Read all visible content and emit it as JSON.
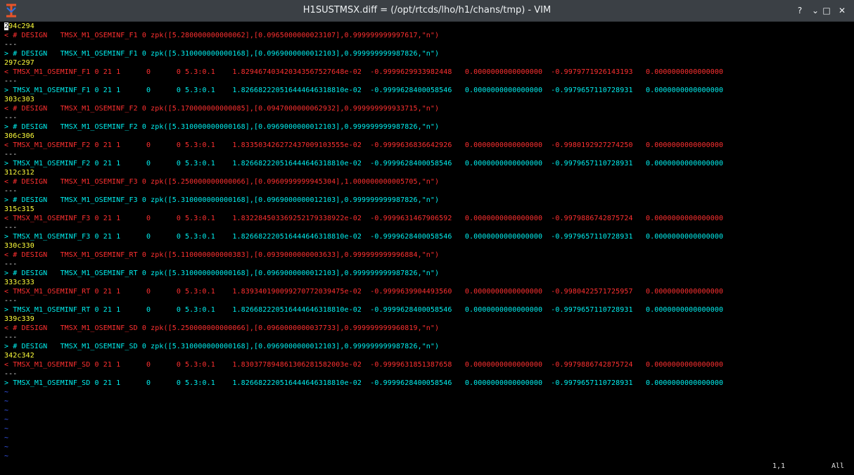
{
  "window": {
    "title": "H1SUSTMSX.diff = (/opt/rtcds/lho/h1/chans/tmp) - VIM",
    "buttons": {
      "help": "?",
      "minimize": "⌄",
      "maximize": "□",
      "close": "✕"
    }
  },
  "colors": {
    "hunk": "#ffff3c",
    "removed": "#ff3030",
    "added": "#00f0f0",
    "separator": "#e8e8e8",
    "tilde": "#3a5cff"
  },
  "lines": [
    {
      "type": "hunk",
      "text": "294c294"
    },
    {
      "type": "removed",
      "text": "< # DESIGN   TMSX_M1_OSEMINF_F1 0 zpk([5.280000000000062],[0.0965000000023107],0.999999999997617,\"n\")"
    },
    {
      "type": "separator",
      "text": "---"
    },
    {
      "type": "added",
      "text": "> # DESIGN   TMSX_M1_OSEMINF_F1 0 zpk([5.310000000000168],[0.0969000000012103],0.999999999987826,\"n\")"
    },
    {
      "type": "hunk",
      "text": "297c297"
    },
    {
      "type": "removed",
      "text": "< TMSX_M1_OSEMINF_F1 0 21 1      0      0 5.3:0.1    1.829467403420343567527648e-02  -0.9999629933982448   0.0000000000000000  -0.9979771926143193   0.0000000000000000"
    },
    {
      "type": "separator",
      "text": "---"
    },
    {
      "type": "added",
      "text": "> TMSX_M1_OSEMINF_F1 0 21 1      0      0 5.3:0.1    1.826682220516444646318810e-02  -0.9999628400058546   0.0000000000000000  -0.9979657110728931   0.0000000000000000"
    },
    {
      "type": "hunk",
      "text": "303c303"
    },
    {
      "type": "removed",
      "text": "< # DESIGN   TMSX_M1_OSEMINF_F2 0 zpk([5.170000000000085],[0.0947000000062932],0.999999999933715,\"n\")"
    },
    {
      "type": "separator",
      "text": "---"
    },
    {
      "type": "added",
      "text": "> # DESIGN   TMSX_M1_OSEMINF_F2 0 zpk([5.310000000000168],[0.0969000000012103],0.999999999987826,\"n\")"
    },
    {
      "type": "hunk",
      "text": "306c306"
    },
    {
      "type": "removed",
      "text": "< TMSX_M1_OSEMINF_F2 0 21 1      0      0 5.3:0.1    1.833503426272437009103555e-02  -0.9999636836642926   0.0000000000000000  -0.9980192927274250   0.0000000000000000"
    },
    {
      "type": "separator",
      "text": "---"
    },
    {
      "type": "added",
      "text": "> TMSX_M1_OSEMINF_F2 0 21 1      0      0 5.3:0.1    1.826682220516444646318810e-02  -0.9999628400058546   0.0000000000000000  -0.9979657110728931   0.0000000000000000"
    },
    {
      "type": "hunk",
      "text": "312c312"
    },
    {
      "type": "removed",
      "text": "< # DESIGN   TMSX_M1_OSEMINF_F3 0 zpk([5.250000000000066],[0.0960999999945304],1.000000000005705,\"n\")"
    },
    {
      "type": "separator",
      "text": "---"
    },
    {
      "type": "added",
      "text": "> # DESIGN   TMSX_M1_OSEMINF_F3 0 zpk([5.310000000000168],[0.0969000000012103],0.999999999987826,\"n\")"
    },
    {
      "type": "hunk",
      "text": "315c315"
    },
    {
      "type": "removed",
      "text": "< TMSX_M1_OSEMINF_F3 0 21 1      0      0 5.3:0.1    1.832284503369252179338922e-02  -0.9999631467906592   0.0000000000000000  -0.9979886742875724   0.0000000000000000"
    },
    {
      "type": "separator",
      "text": "---"
    },
    {
      "type": "added",
      "text": "> TMSX_M1_OSEMINF_F3 0 21 1      0      0 5.3:0.1    1.826682220516444646318810e-02  -0.9999628400058546   0.0000000000000000  -0.9979657110728931   0.0000000000000000"
    },
    {
      "type": "hunk",
      "text": "330c330"
    },
    {
      "type": "removed",
      "text": "< # DESIGN   TMSX_M1_OSEMINF_RT 0 zpk([5.110000000000383],[0.0939000000003633],0.999999999996884,\"n\")"
    },
    {
      "type": "separator",
      "text": "---"
    },
    {
      "type": "added",
      "text": "> # DESIGN   TMSX_M1_OSEMINF_RT 0 zpk([5.310000000000168],[0.0969000000012103],0.999999999987826,\"n\")"
    },
    {
      "type": "hunk",
      "text": "333c333"
    },
    {
      "type": "removed",
      "text": "< TMSX_M1_OSEMINF_RT 0 21 1      0      0 5.3:0.1    1.839340190099270772039475e-02  -0.9999639904493560   0.0000000000000000  -0.9980422571725957   0.0000000000000000"
    },
    {
      "type": "separator",
      "text": "---"
    },
    {
      "type": "added",
      "text": "> TMSX_M1_OSEMINF_RT 0 21 1      0      0 5.3:0.1    1.826682220516444646318810e-02  -0.9999628400058546   0.0000000000000000  -0.9979657110728931   0.0000000000000000"
    },
    {
      "type": "hunk",
      "text": "339c339"
    },
    {
      "type": "removed",
      "text": "< # DESIGN   TMSX_M1_OSEMINF_SD 0 zpk([5.250000000000066],[0.0960000000037733],0.999999999960819,\"n\")"
    },
    {
      "type": "separator",
      "text": "---"
    },
    {
      "type": "added",
      "text": "> # DESIGN   TMSX_M1_OSEMINF_SD 0 zpk([5.310000000000168],[0.0969000000012103],0.999999999987826,\"n\")"
    },
    {
      "type": "hunk",
      "text": "342c342"
    },
    {
      "type": "removed",
      "text": "< TMSX_M1_OSEMINF_SD 0 21 1      0      0 5.3:0.1    1.830377894861306281582003e-02  -0.9999631851387658   0.0000000000000000  -0.9979886742875724   0.0000000000000000"
    },
    {
      "type": "separator",
      "text": "---"
    },
    {
      "type": "added",
      "text": "> TMSX_M1_OSEMINF_SD 0 21 1      0      0 5.3:0.1    1.826682220516444646318810e-02  -0.9999628400058546   0.0000000000000000  -0.9979657110728931   0.0000000000000000"
    },
    {
      "type": "tilde",
      "text": "~"
    },
    {
      "type": "tilde",
      "text": "~"
    },
    {
      "type": "tilde",
      "text": "~"
    },
    {
      "type": "tilde",
      "text": "~"
    },
    {
      "type": "tilde",
      "text": "~"
    },
    {
      "type": "tilde",
      "text": "~"
    },
    {
      "type": "tilde",
      "text": "~"
    },
    {
      "type": "tilde",
      "text": "~"
    }
  ],
  "status": {
    "position": "1,1",
    "scroll": "All"
  }
}
